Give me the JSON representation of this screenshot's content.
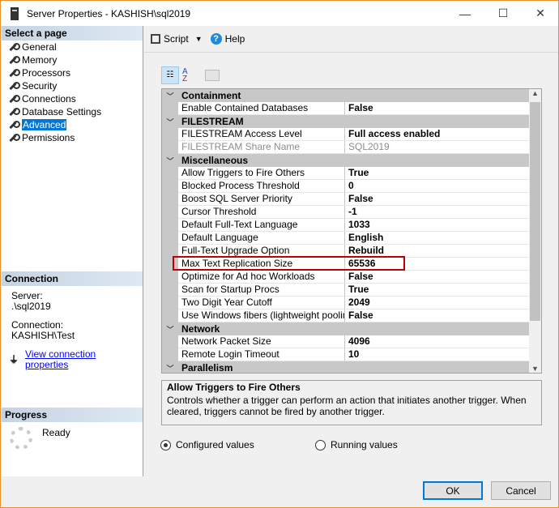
{
  "window": {
    "title": "Server Properties - KASHISH\\sql2019",
    "minimize": "—",
    "maximize": "☐",
    "close": "✕"
  },
  "sidebar": {
    "header": "Select a page",
    "items": [
      {
        "label": "General"
      },
      {
        "label": "Memory"
      },
      {
        "label": "Processors"
      },
      {
        "label": "Security"
      },
      {
        "label": "Connections"
      },
      {
        "label": "Database Settings"
      },
      {
        "label": "Advanced",
        "selected": true
      },
      {
        "label": "Permissions"
      }
    ]
  },
  "connection": {
    "header": "Connection",
    "server_label": "Server:",
    "server": ".\\sql2019",
    "connection_label": "Connection:",
    "connection": "KASHISH\\Test",
    "link": "View connection properties"
  },
  "progress": {
    "header": "Progress",
    "status": "Ready"
  },
  "toolbar": {
    "script": "Script",
    "help": "Help"
  },
  "grid": {
    "rows": [
      {
        "type": "cat",
        "label": "Containment"
      },
      {
        "name": "Enable Contained Databases",
        "value": "False"
      },
      {
        "type": "cat",
        "label": "FILESTREAM"
      },
      {
        "name": "FILESTREAM Access Level",
        "value": "Full access enabled"
      },
      {
        "name": "FILESTREAM Share Name",
        "value": "SQL2019",
        "disabled": true
      },
      {
        "type": "cat",
        "label": "Miscellaneous"
      },
      {
        "name": "Allow Triggers to Fire Others",
        "value": "True"
      },
      {
        "name": "Blocked Process Threshold",
        "value": "0"
      },
      {
        "name": "Boost SQL Server Priority",
        "value": "False"
      },
      {
        "name": "Cursor Threshold",
        "value": "-1"
      },
      {
        "name": "Default Full-Text Language",
        "value": "1033"
      },
      {
        "name": "Default Language",
        "value": "English"
      },
      {
        "name": "Full-Text Upgrade Option",
        "value": "Rebuild"
      },
      {
        "name": "Max Text Replication Size",
        "value": "65536",
        "highlighted": true
      },
      {
        "name": "Optimize for Ad hoc Workloads",
        "value": "False"
      },
      {
        "name": "Scan for Startup Procs",
        "value": "True"
      },
      {
        "name": "Two Digit Year Cutoff",
        "value": "2049"
      },
      {
        "name": "Use Windows fibers (lightweight pooling)",
        "value": "False"
      },
      {
        "type": "cat",
        "label": "Network"
      },
      {
        "name": "Network Packet Size",
        "value": "4096"
      },
      {
        "name": "Remote Login Timeout",
        "value": "10"
      },
      {
        "type": "cat",
        "label": "Parallelism"
      }
    ]
  },
  "description": {
    "title": "Allow Triggers to Fire Others",
    "text": "Controls whether a trigger can perform an action that initiates another trigger. When cleared, triggers cannot be fired by another trigger."
  },
  "options": {
    "configured": "Configured values",
    "running": "Running values",
    "selected": "configured"
  },
  "buttons": {
    "ok": "OK",
    "cancel": "Cancel"
  },
  "colors": {
    "accent": "#0078d7",
    "highlight_box": "#c00000",
    "window_border": "#e8912a"
  }
}
